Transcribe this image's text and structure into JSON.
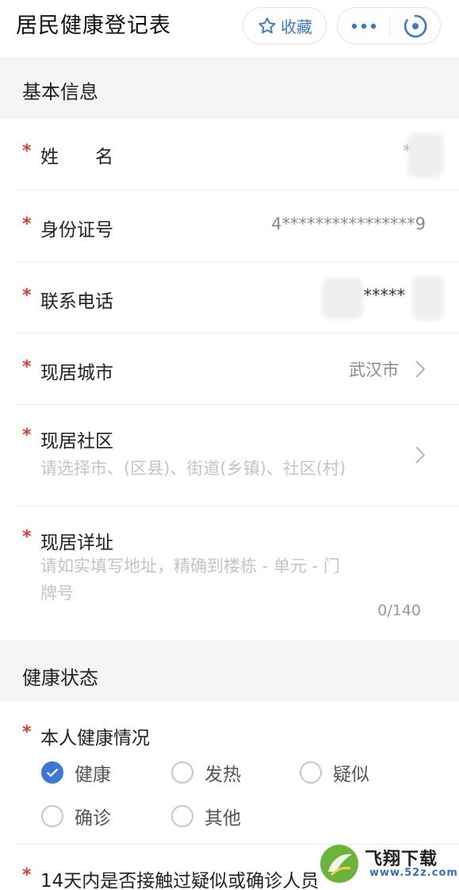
{
  "header": {
    "title": "居民健康登记表",
    "favorite_label": "收藏",
    "more_icon": "more-icon",
    "close_icon": "close-miniprogram-icon",
    "accent_color": "#3b78d8"
  },
  "sections": {
    "basic_info": "基本信息",
    "health_status": "健康状态"
  },
  "fields": {
    "name": {
      "label": "姓　　名",
      "value": "*",
      "required": true
    },
    "id_number": {
      "label": "身份证号",
      "value": "4****************9",
      "required": true
    },
    "phone": {
      "label": "联系电话",
      "value": "*****",
      "required": true
    },
    "city": {
      "label": "现居城市",
      "value": "武汉市",
      "required": true
    },
    "community": {
      "label": "现居社区",
      "placeholder": "请选择市、(区县)、街道(乡镇)、社区(村)",
      "required": true
    },
    "address": {
      "label": "现居详址",
      "placeholder_line1": "请如实填写地址，精确到楼栋 - 单元 - 门",
      "placeholder_line2": "牌号",
      "counter": "0/140",
      "required": true
    }
  },
  "health": {
    "label": "本人健康情况",
    "required": true,
    "options": [
      "健康",
      "发热",
      "疑似",
      "确诊",
      "其他"
    ],
    "selected": "健康"
  },
  "contact_question": {
    "label": "14天内是否接触过疑似或确诊人员",
    "required": true
  },
  "required_mark": "*",
  "watermark": {
    "title": "飞翔下载",
    "url": "www.52z.com"
  }
}
